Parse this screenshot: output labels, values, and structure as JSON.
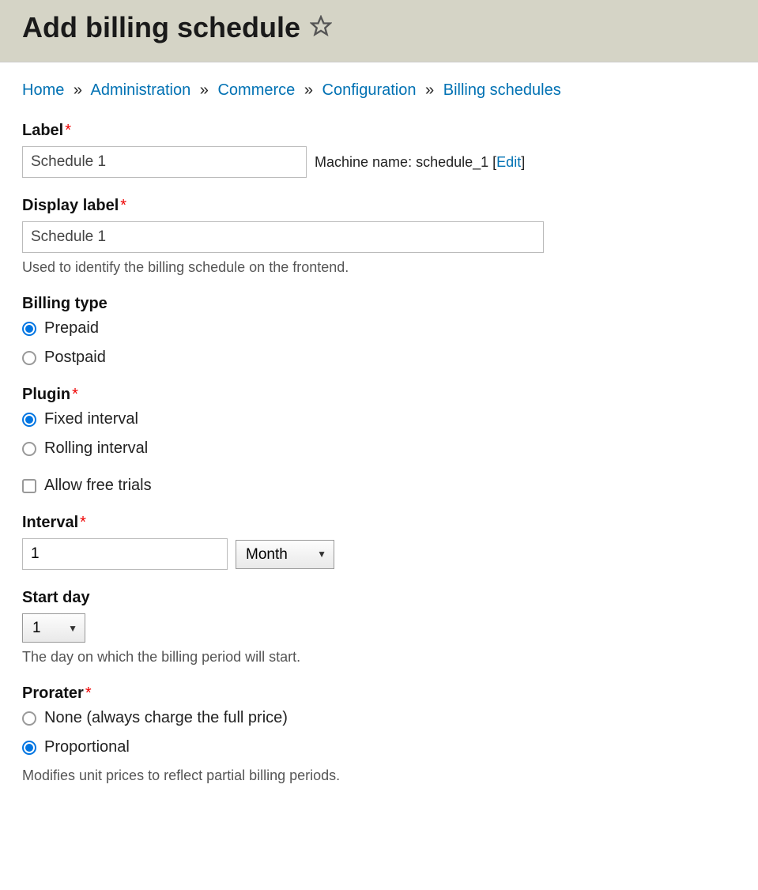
{
  "page": {
    "title": "Add billing schedule"
  },
  "breadcrumb": {
    "items": [
      "Home",
      "Administration",
      "Commerce",
      "Configuration",
      "Billing schedules"
    ],
    "separator": "»"
  },
  "form": {
    "label": {
      "label": "Label",
      "value": "Schedule 1",
      "machine_prefix": "Machine name: ",
      "machine_name": "schedule_1",
      "edit_text": "Edit"
    },
    "display_label": {
      "label": "Display label",
      "value": "Schedule 1",
      "help": "Used to identify the billing schedule on the frontend."
    },
    "billing_type": {
      "label": "Billing type",
      "options": [
        {
          "label": "Prepaid",
          "checked": true
        },
        {
          "label": "Postpaid",
          "checked": false
        }
      ]
    },
    "plugin": {
      "label": "Plugin",
      "options": [
        {
          "label": "Fixed interval",
          "checked": true
        },
        {
          "label": "Rolling interval",
          "checked": false
        }
      ]
    },
    "allow_trials": {
      "label": "Allow free trials",
      "checked": false
    },
    "interval": {
      "label": "Interval",
      "number": "1",
      "unit": "Month"
    },
    "start_day": {
      "label": "Start day",
      "value": "1",
      "help": "The day on which the billing period will start."
    },
    "prorater": {
      "label": "Prorater",
      "options": [
        {
          "label": "None (always charge the full price)",
          "checked": false
        },
        {
          "label": "Proportional",
          "checked": true
        }
      ],
      "help": "Modifies unit prices to reflect partial billing periods."
    }
  }
}
